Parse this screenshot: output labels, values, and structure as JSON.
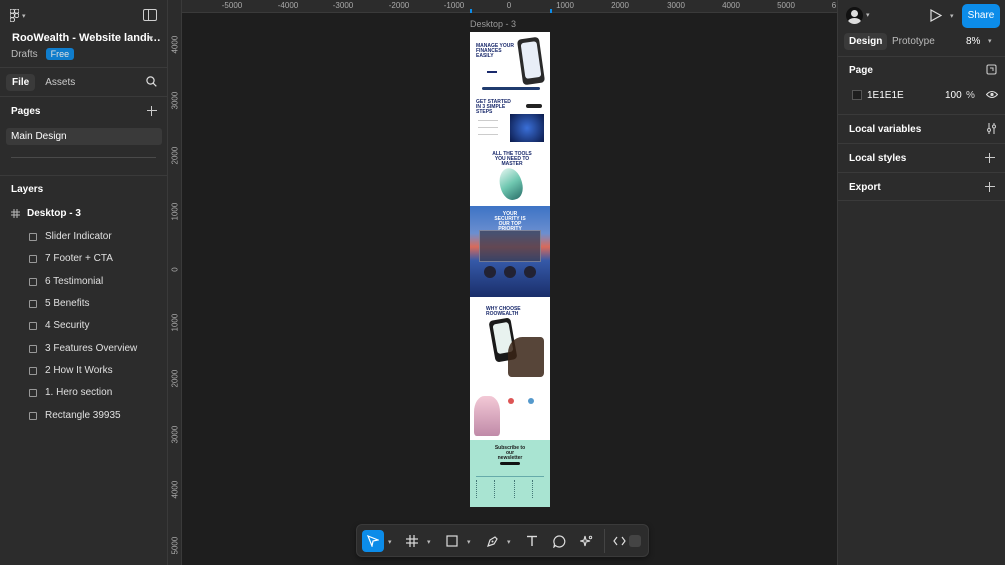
{
  "left_panel": {
    "file_title": "RooWealth - Website landi…",
    "file_location": "Drafts",
    "plan_badge": "Free",
    "tabs": [
      "File",
      "Assets"
    ],
    "pages_heading": "Pages",
    "pages": [
      "Main Design"
    ],
    "layers_heading": "Layers",
    "root_layer": "Desktop - 3",
    "layers": [
      "Slider Indicator",
      "7 Footer + CTA",
      "6 Testimonial",
      "5 Benefits",
      "4 Security",
      "3 Features Overview",
      "2 How It Works",
      "1. Hero section",
      "Rectangle 39935"
    ]
  },
  "canvas": {
    "frame_label": "Desktop - 3",
    "ruler_top": [
      "-5000",
      "-4000",
      "-3000",
      "-2000",
      "-1000",
      "0",
      "1000",
      "2000",
      "3000",
      "4000",
      "5000",
      "6"
    ],
    "ruler_left": [
      "4000",
      "3000",
      "2000",
      "1000",
      "0",
      "1000",
      "2000",
      "3000",
      "4000",
      "5000"
    ],
    "frame_text": {
      "hero": "MANAGE YOUR FINANCES EASILY",
      "steps": "GET STARTED IN 3 SIMPLE STEPS",
      "tools": "ALL THE TOOLS YOU NEED TO MASTER",
      "security": "YOUR SECURITY IS OUR TOP PRIORITY",
      "why": "WHY CHOOSE ROOWEALTH",
      "newsletter": "Subscribe to our newsletter"
    }
  },
  "toolbar": {
    "tools": [
      "move-tool",
      "frame-tool",
      "shape-tool",
      "pen-tool",
      "text-tool",
      "comment-tool",
      "actions-tool",
      "dev-mode-toggle"
    ]
  },
  "right_panel": {
    "share_label": "Share",
    "tabs": [
      "Design",
      "Prototype"
    ],
    "zoom": "8%",
    "page_heading": "Page",
    "page_color": "1E1E1E",
    "page_opacity": "100",
    "percent_sign": "%",
    "sections": [
      "Local variables",
      "Local styles",
      "Export"
    ]
  },
  "help_label": "?",
  "colors": {
    "accent": "#0c8ce9",
    "panel_bg": "#2c2c2c",
    "canvas_bg": "#1e1e1e"
  }
}
